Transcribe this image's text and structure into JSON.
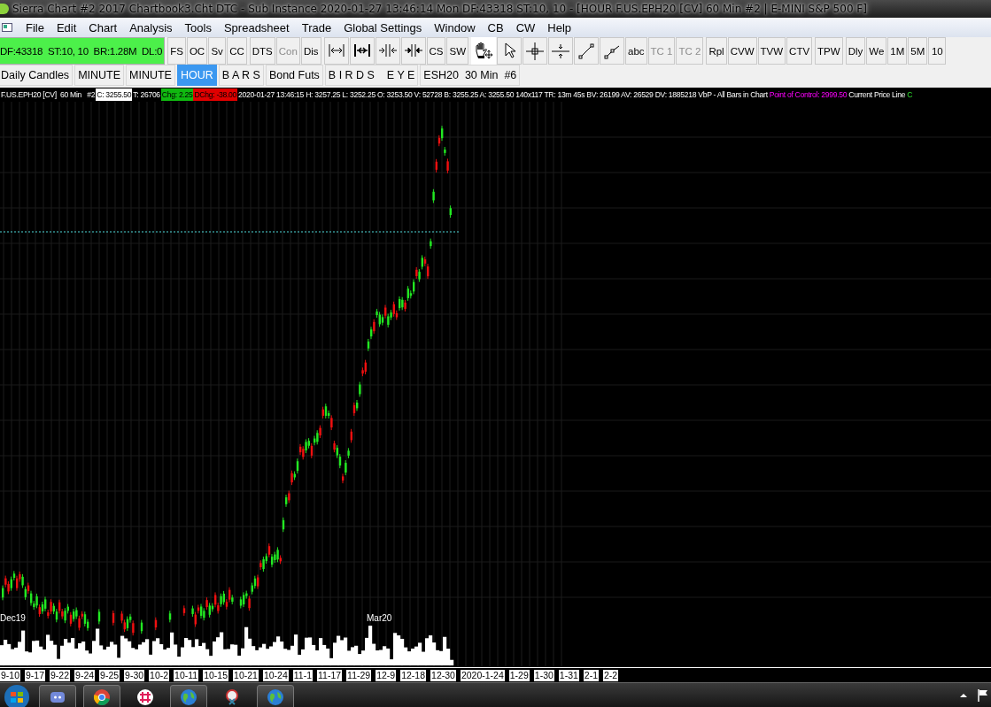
{
  "window": {
    "title": "Sierra Chart #2 2017 Chartbook3.Cht  DTC - Sub Instance 2020-01-27  13:46:14 Mon  DF:43318  ST:10, 10 - [HOUR  F.US.EPH20 [CV]  60 Min   #2 | E-MINI S&P 500 F]"
  },
  "menu": [
    "File",
    "Edit",
    "Chart",
    "Analysis",
    "Tools",
    "Spreadsheet",
    "Trade",
    "Global Settings",
    "Window",
    "CB",
    "CW",
    "Help"
  ],
  "status_box": "DF:43318  ST:10, 10  BR:1.28M  DL:0",
  "toolbar": [
    [
      {
        "kind": "text",
        "label": "FS",
        "disabled": false
      },
      {
        "kind": "text",
        "label": "OC",
        "disabled": false
      },
      {
        "kind": "text",
        "label": "Sv",
        "disabled": false
      },
      {
        "kind": "text",
        "label": "CC",
        "disabled": false
      }
    ],
    [
      {
        "kind": "text",
        "label": "DTS",
        "disabled": false
      },
      {
        "kind": "text",
        "label": "Con",
        "disabled": true
      },
      {
        "kind": "text",
        "label": "Dis",
        "disabled": false
      }
    ],
    [
      {
        "kind": "icon",
        "selected": false
      },
      {
        "kind": "icon",
        "selected": false
      },
      {
        "kind": "icon",
        "selected": false
      },
      {
        "kind": "icon",
        "selected": false
      },
      {
        "kind": "text",
        "label": "CS",
        "disabled": false
      },
      {
        "kind": "text",
        "label": "SW",
        "disabled": false
      }
    ],
    [
      {
        "kind": "icon",
        "selected": true
      },
      {
        "kind": "icon",
        "selected": false
      },
      {
        "kind": "icon",
        "selected": false
      },
      {
        "kind": "icon",
        "selected": false
      },
      {
        "kind": "icon",
        "selected": false
      },
      {
        "kind": "icon",
        "selected": false
      },
      {
        "kind": "text",
        "label": "abc",
        "disabled": false
      },
      {
        "kind": "text",
        "label": "TC 1",
        "disabled": true
      },
      {
        "kind": "text",
        "label": "TC 2",
        "disabled": true
      }
    ],
    [
      {
        "kind": "text",
        "label": "Rpl",
        "disabled": false
      },
      {
        "kind": "text",
        "label": "CVW",
        "disabled": false
      },
      {
        "kind": "text",
        "label": "TVW",
        "disabled": false
      },
      {
        "kind": "text",
        "label": "CTV",
        "disabled": false
      }
    ],
    [
      {
        "kind": "text",
        "label": "TPW",
        "disabled": false
      }
    ],
    [
      {
        "kind": "text",
        "label": "Dly",
        "disabled": false
      },
      {
        "kind": "text",
        "label": "We",
        "disabled": false
      },
      {
        "kind": "text",
        "label": "1M",
        "disabled": false
      },
      {
        "kind": "text",
        "label": "5M",
        "disabled": false
      },
      {
        "kind": "text",
        "label": "10",
        "disabled": false
      }
    ]
  ],
  "tabs": [
    {
      "label": "Daily Candles",
      "selected": false
    },
    {
      "label": "MINUTE",
      "selected": false
    },
    {
      "label": "MINUTE",
      "selected": false
    },
    {
      "label": "HOUR",
      "selected": true
    },
    {
      "label": "B A R S",
      "selected": false
    },
    {
      "label": "Bond Futs",
      "selected": false
    },
    {
      "label": "B I R D S    E Y E",
      "selected": false
    },
    {
      "label": "ESH20  30 Min  #6",
      "selected": false
    }
  ],
  "info_line": [
    {
      "kind": "plain",
      "text": "F.US.EPH20 [CV]  60 Min   #2"
    },
    {
      "kind": "boxed",
      "text": "C: 3255.50"
    },
    {
      "kind": "plain",
      "text": "T: 26706"
    },
    {
      "kind": "up",
      "text": "Chg: 2.25"
    },
    {
      "kind": "down",
      "text": "DChg: -38.00"
    },
    {
      "kind": "plain",
      "text": "2020-01-27 13:46:15 H: 3257.25 L: 3252.25 O: 3253.50 V: 52728 B: 3255.25 A: 3255.50 140x117 TR: 13m 45s BV: 26199 AV: 26529 DV: 1885218 VbP - All Bars in Chart"
    },
    {
      "kind": "poc",
      "text": "Point of Control: 2999.50"
    },
    {
      "kind": "plain",
      "text": "Current Price Line"
    },
    {
      "kind": "study",
      "text": "C"
    }
  ],
  "chart": {
    "labels": [
      {
        "text": "Dec19"
      },
      {
        "text": "Mar20"
      }
    ]
  },
  "date_axis": [
    "9-10",
    "9-17",
    "9-22",
    "9-24",
    "9-25",
    "9-30",
    "10-2",
    "10-11",
    "10-15",
    "10-21",
    "10-24",
    "11-1",
    "11-17",
    "11-29",
    "12-9",
    "12-18",
    "12-30",
    "2020-1-24",
    "1-29",
    "1-30",
    "1-31",
    "2-1",
    "2-2"
  ]
}
